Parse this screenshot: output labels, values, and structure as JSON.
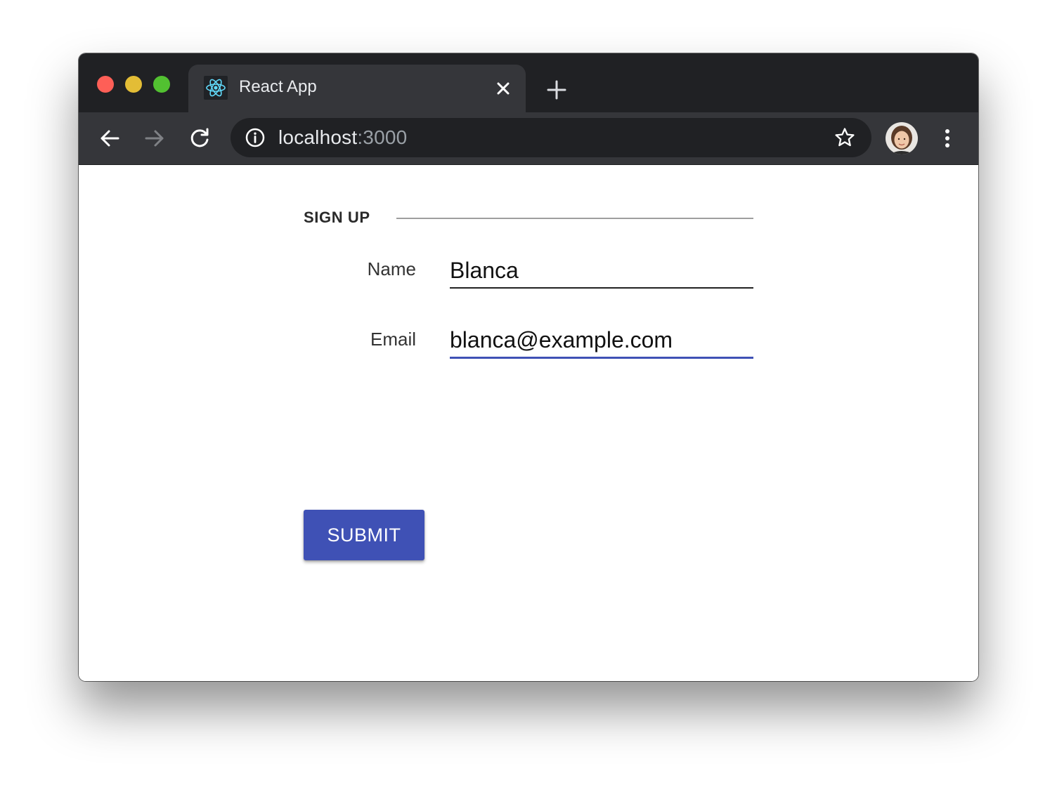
{
  "browser": {
    "tab": {
      "title": "React App",
      "favicon": "react-logo-icon",
      "close_icon": "close-icon"
    },
    "new_tab_icon": "plus-icon",
    "nav": {
      "back_icon": "arrow-left-icon",
      "forward_icon": "arrow-right-icon",
      "reload_icon": "reload-icon"
    },
    "address": {
      "info_icon": "info-icon",
      "host": "localhost",
      "port": ":3000",
      "bookmark_icon": "star-icon"
    },
    "profile_icon": "avatar",
    "menu_icon": "more-vert-icon"
  },
  "form": {
    "title": "SIGN UP",
    "fields": [
      {
        "label": "Name",
        "value": "Blanca"
      },
      {
        "label": "Email",
        "value": "blanca@example.com"
      }
    ],
    "submit_label": "SUBMIT"
  },
  "colors": {
    "accent": "#3f51b5",
    "titlebar": "#202124",
    "toolbar": "#35363a",
    "react": "#61dafb"
  }
}
